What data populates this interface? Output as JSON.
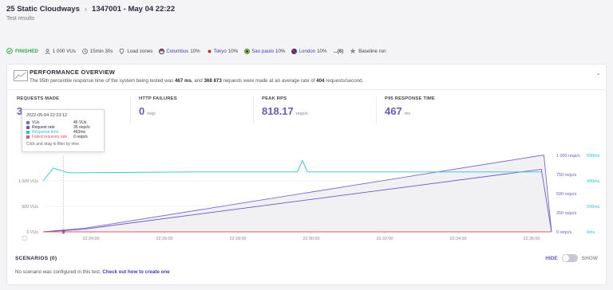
{
  "header": {
    "project": "25 Static Cloudways",
    "test_id": "1347001 - May 04 22:22",
    "subtitle": "Test results"
  },
  "status": {
    "finished": "FINISHED",
    "vus": "1 000 VUs",
    "duration": "15min 30s",
    "load_zones_label": "Load zones",
    "zones": [
      {
        "name": "Columbus",
        "pct": "10%",
        "color": "#c33a3a"
      },
      {
        "name": "Tokyo",
        "pct": "10%",
        "color": "#d12a2a"
      },
      {
        "name": "Sao paulo",
        "pct": "10%",
        "color": "#2f9a3f"
      },
      {
        "name": "London",
        "pct": "10%",
        "color": "#233b8b"
      }
    ],
    "more": "...(6)",
    "baseline": "Baseline run"
  },
  "overview": {
    "title": "PERFORMANCE OVERVIEW",
    "desc_pre": "The 95th percentile response time of the system being tested was ",
    "p95_bold": "467 ms",
    "desc_mid": ", and ",
    "requests_bold": "368 873",
    "desc_mid2": " requests were made at an average rate of ",
    "rate_bold": "404",
    "desc_post": " requests/second."
  },
  "metrics": [
    {
      "label": "REQUESTS MADE",
      "value": "3",
      "unit": ""
    },
    {
      "label": "HTTP FAILURES",
      "value": "0",
      "unit": "reqs"
    },
    {
      "label": "PEAK RPS",
      "value": "818.17",
      "unit": "reqs/s"
    },
    {
      "label": "P95 RESPONSE TIME",
      "value": "467",
      "unit": "ms"
    }
  ],
  "tooltip": {
    "time": "2022-05-04 22:23:12",
    "rows": [
      {
        "key": "VUs",
        "val": "46 VUs",
        "color": "#7a6bd0"
      },
      {
        "key": "Request rate",
        "val": "35 reqs/s",
        "color": "#6b59c7"
      },
      {
        "key": "Response time",
        "val": "463ms",
        "color": "#2ac3dc"
      },
      {
        "key": "Failed requests rate",
        "val": "0 reqs/s",
        "color": "#e8556b"
      }
    ],
    "hint": "Click and drag to filter by time."
  },
  "chart_data": {
    "type": "line",
    "x_ticks": [
      "22:24:00",
      "22:26:00",
      "22:28:00",
      "22:30:00",
      "22:32:00",
      "22:34:00",
      "22:36:00"
    ],
    "y_left_ticks": [
      "0 VUs",
      "500 VUs",
      "1 000 VUs"
    ],
    "y_right_reqs_ticks": [
      "0 reqs/s",
      "250 reqs/s",
      "500 reqs/s",
      "750 reqs/s",
      "1 000 reqs/s"
    ],
    "y_right_ms_ticks": [
      "0ms",
      "200ms",
      "400ms",
      "600ms"
    ],
    "series": [
      {
        "name": "VUs",
        "color": "#7a6bd0",
        "x": [
          0,
          0.08,
          0.98,
          0.985,
          1
        ],
        "y": [
          0,
          46,
          1000,
          1000,
          0
        ]
      },
      {
        "name": "Request rate",
        "color": "#6b59c7",
        "x": [
          0,
          0.08,
          0.98,
          1
        ],
        "y": [
          0,
          35,
          818,
          0
        ]
      },
      {
        "name": "Response time",
        "color": "#2ac3dc",
        "x": [
          0,
          0.02,
          0.05,
          0.3,
          0.5,
          0.51,
          0.52,
          0.7,
          0.98
        ],
        "y": [
          400,
          500,
          463,
          470,
          470,
          560,
          470,
          470,
          470
        ]
      },
      {
        "name": "Failed requests rate",
        "color": "#e8556b",
        "x": [
          0,
          1
        ],
        "y": [
          0,
          0
        ]
      }
    ]
  },
  "scenarios": {
    "title": "SCENARIOS (0)",
    "msg": "No scenario was configured in this test.",
    "link": "Check out how to create one",
    "hide": "HIDE",
    "show": "SHOW"
  },
  "colors": {
    "accent": "#6b59c7",
    "cyan": "#2ac3dc",
    "pink": "#e8556b",
    "green": "#3aa655"
  }
}
